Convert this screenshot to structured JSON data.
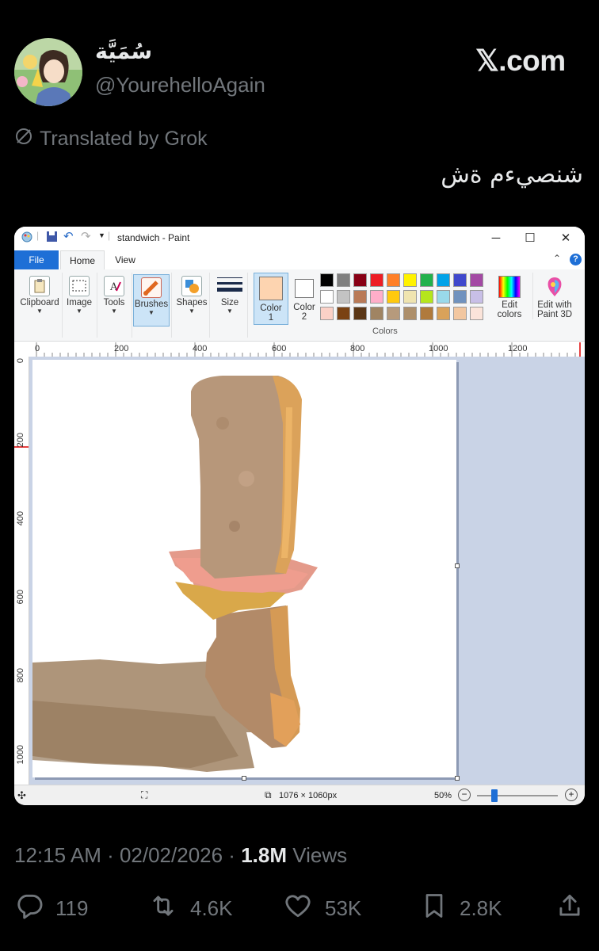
{
  "tweet": {
    "display_name": "سُمَيَّة",
    "handle": "@YourehelloAgain",
    "brand": "𝕏.com",
    "translated_label": "Translated by Grok",
    "text": "شنصيءم ةش",
    "time": "12:15 AM · 02/02/2026 · ",
    "views_count": "1.8M",
    "views_label": " Views",
    "replies": "119",
    "reposts": "4.6K",
    "likes": "53K",
    "bookmarks": "2.8K"
  },
  "paint": {
    "title": "standwich - Paint",
    "tabs": {
      "file": "File",
      "home": "Home",
      "view": "View"
    },
    "ribbon": {
      "clipboard": "Clipboard",
      "image": "Image",
      "tools": "Tools",
      "brushes": "Brushes",
      "shapes": "Shapes",
      "size": "Size",
      "color1_a": "Color",
      "color1_b": "1",
      "color2_a": "Color",
      "color2_b": "2",
      "edit_colors_a": "Edit",
      "edit_colors_b": "colors",
      "edit_3d_a": "Edit with",
      "edit_3d_b": "Paint 3D",
      "colors_group": "Colors"
    },
    "color1_hex": "#fdd4b0",
    "color2_hex": "#ffffff",
    "palette_row1": [
      "#000000",
      "#7f7f7f",
      "#880015",
      "#ed1c24",
      "#ff7f27",
      "#fff200",
      "#22b14c",
      "#00a2e8",
      "#3f48cc",
      "#a349a4"
    ],
    "palette_row2": [
      "#ffffff",
      "#c3c3c3",
      "#b97a57",
      "#ffaec9",
      "#ffc90e",
      "#efe4b0",
      "#b5e61d",
      "#99d9ea",
      "#7092be",
      "#c8bfe7"
    ],
    "palette_row3": [
      "#fbd1c7",
      "#7a4213",
      "#5b3716",
      "#a08463",
      "#b69a7c",
      "#ad8f6b",
      "#b07a3c",
      "#d9a25a",
      "#f2c7a0",
      "#fbe4da"
    ],
    "ruler_top": [
      "0",
      "200",
      "400",
      "600",
      "800",
      "1000",
      "1200"
    ],
    "ruler_left": [
      "0",
      "200",
      "400",
      "600",
      "800",
      "1000"
    ],
    "status": {
      "dimensions": "1076 × 1060px",
      "zoom": "50%",
      "zoom_fraction": 0.5
    }
  }
}
